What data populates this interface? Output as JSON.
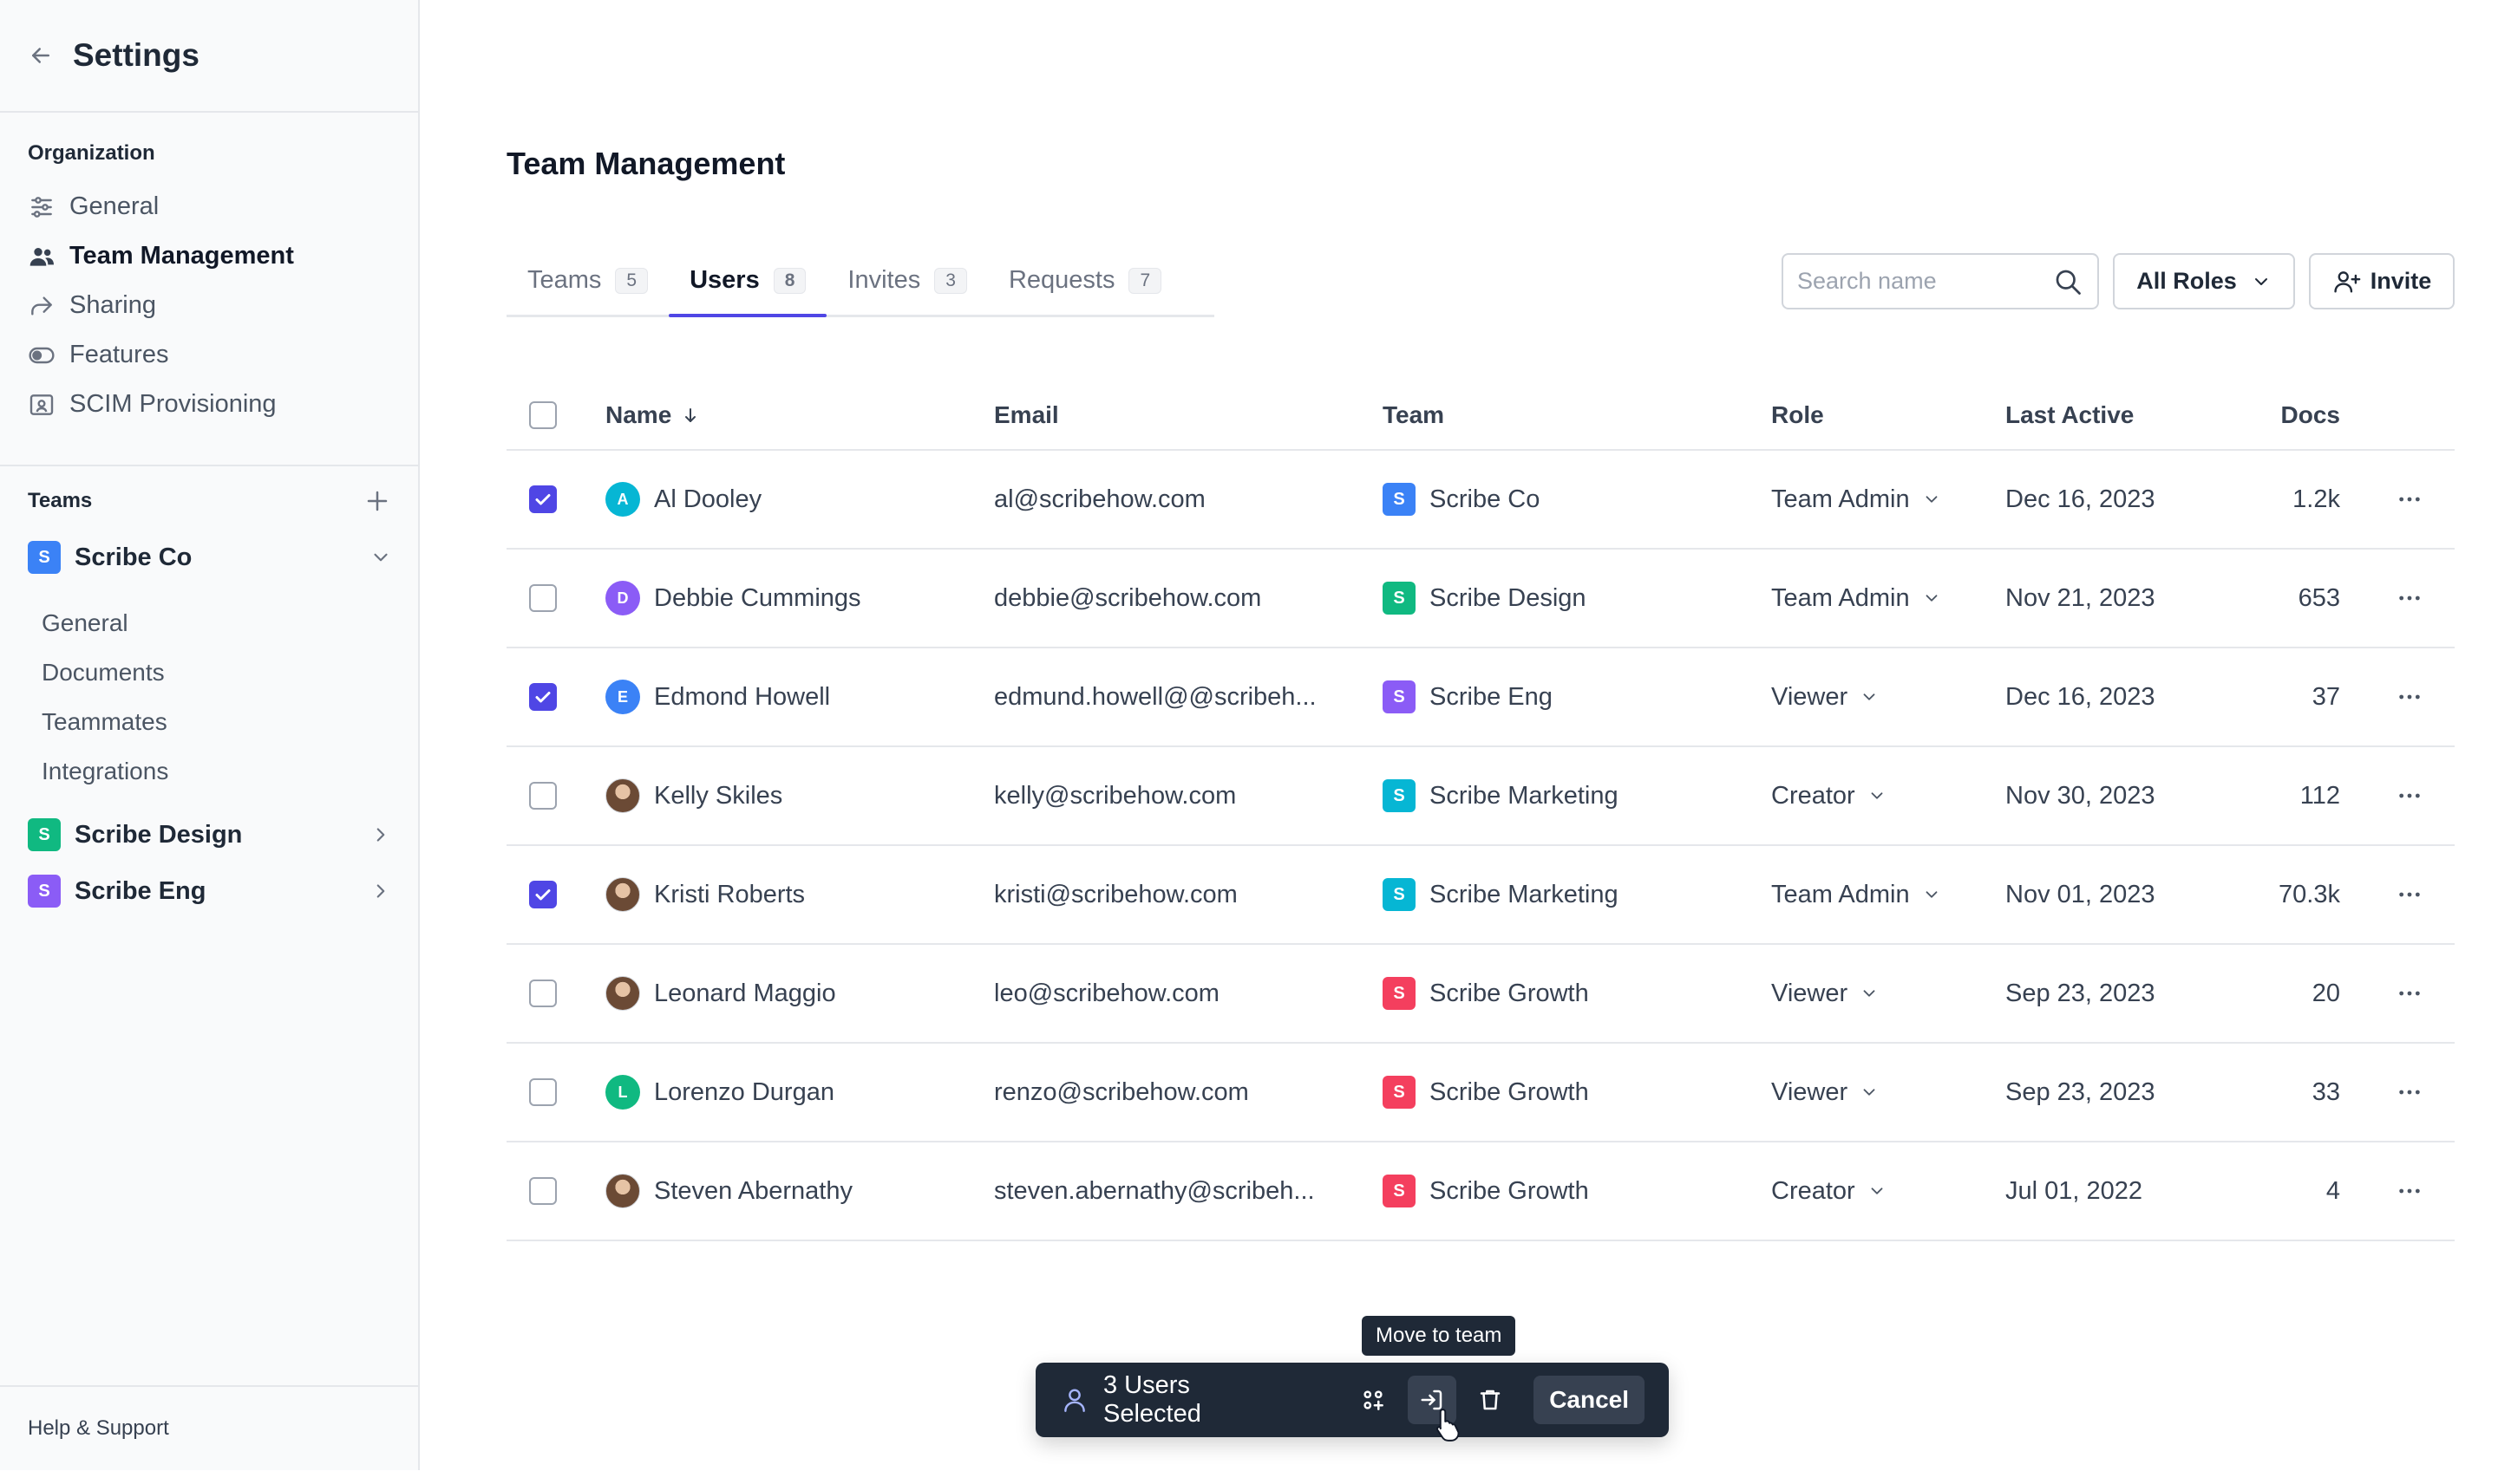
{
  "sidebar": {
    "title": "Settings",
    "org_label": "Organization",
    "nav": [
      {
        "label": "General",
        "icon": "sliders-icon"
      },
      {
        "label": "Team Management",
        "icon": "users-icon",
        "active": true
      },
      {
        "label": "Sharing",
        "icon": "share-icon"
      },
      {
        "label": "Features",
        "icon": "toggle-icon"
      },
      {
        "label": "SCIM Provisioning",
        "icon": "id-card-icon"
      }
    ],
    "teams_label": "Teams",
    "teams": [
      {
        "badge": "S",
        "name": "Scribe Co",
        "color": "#3b82f6",
        "expanded": true
      },
      {
        "badge": "S",
        "name": "Scribe Design",
        "color": "#10b981"
      },
      {
        "badge": "S",
        "name": "Scribe Eng",
        "color": "#8b5cf6"
      }
    ],
    "subnav": [
      "General",
      "Documents",
      "Teammates",
      "Integrations"
    ],
    "footer": "Help & Support"
  },
  "page": {
    "title": "Team Management",
    "tabs": [
      {
        "label": "Teams",
        "count": "5"
      },
      {
        "label": "Users",
        "count": "8",
        "active": true
      },
      {
        "label": "Invites",
        "count": "3"
      },
      {
        "label": "Requests",
        "count": "7"
      }
    ],
    "search_placeholder": "Search name",
    "roles_filter": "All Roles",
    "invite_label": "Invite"
  },
  "table": {
    "headers": {
      "name": "Name",
      "email": "Email",
      "team": "Team",
      "role": "Role",
      "last_active": "Last Active",
      "docs": "Docs"
    },
    "rows": [
      {
        "checked": true,
        "avatar": "A",
        "avatar_color": "#06b6d4",
        "name": "Al Dooley",
        "email": "al@scribehow.com",
        "team": "Scribe Co",
        "team_color": "#3b82f6",
        "role": "Team Admin",
        "last_active": "Dec 16, 2023",
        "docs": "1.2k"
      },
      {
        "checked": false,
        "avatar": "D",
        "avatar_color": "#8b5cf6",
        "name": "Debbie Cummings",
        "email": "debbie@scribehow.com",
        "team": "Scribe Design",
        "team_color": "#10b981",
        "role": "Team Admin",
        "last_active": "Nov 21, 2023",
        "docs": "653"
      },
      {
        "checked": true,
        "avatar": "E",
        "avatar_color": "#3b82f6",
        "name": "Edmond Howell",
        "email": "edmund.howell@@scribeh...",
        "team": "Scribe Eng",
        "team_color": "#8b5cf6",
        "role": "Viewer",
        "last_active": "Dec 16, 2023",
        "docs": "37"
      },
      {
        "checked": false,
        "avatar": "",
        "avatar_color": "photo",
        "name": "Kelly Skiles",
        "email": "kelly@scribehow.com",
        "team": "Scribe Marketing",
        "team_color": "#06b6d4",
        "role": "Creator",
        "last_active": "Nov 30, 2023",
        "docs": "112"
      },
      {
        "checked": true,
        "avatar": "",
        "avatar_color": "photo",
        "name": "Kristi Roberts",
        "email": "kristi@scribehow.com",
        "team": "Scribe Marketing",
        "team_color": "#06b6d4",
        "role": "Team Admin",
        "last_active": "Nov 01, 2023",
        "docs": "70.3k"
      },
      {
        "checked": false,
        "avatar": "",
        "avatar_color": "photo",
        "name": "Leonard Maggio",
        "email": "leo@scribehow.com",
        "team": "Scribe Growth",
        "team_color": "#f43f5e",
        "role": "Viewer",
        "last_active": "Sep 23, 2023",
        "docs": "20"
      },
      {
        "checked": false,
        "avatar": "L",
        "avatar_color": "#10b981",
        "name": "Lorenzo Durgan",
        "email": "renzo@scribehow.com",
        "team": "Scribe Growth",
        "team_color": "#f43f5e",
        "role": "Viewer",
        "last_active": "Sep 23, 2023",
        "docs": "33"
      },
      {
        "checked": false,
        "avatar": "",
        "avatar_color": "photo",
        "name": "Steven Abernathy",
        "email": "steven.abernathy@scribeh...",
        "team": "Scribe Growth",
        "team_color": "#f43f5e",
        "role": "Creator",
        "last_active": "Jul 01, 2022",
        "docs": "4"
      }
    ]
  },
  "action_bar": {
    "selected_text": "3 Users Selected",
    "tooltip": "Move to team",
    "cancel_label": "Cancel"
  },
  "colors": {
    "accent": "#4f46e5",
    "dark": "#1f2937"
  }
}
